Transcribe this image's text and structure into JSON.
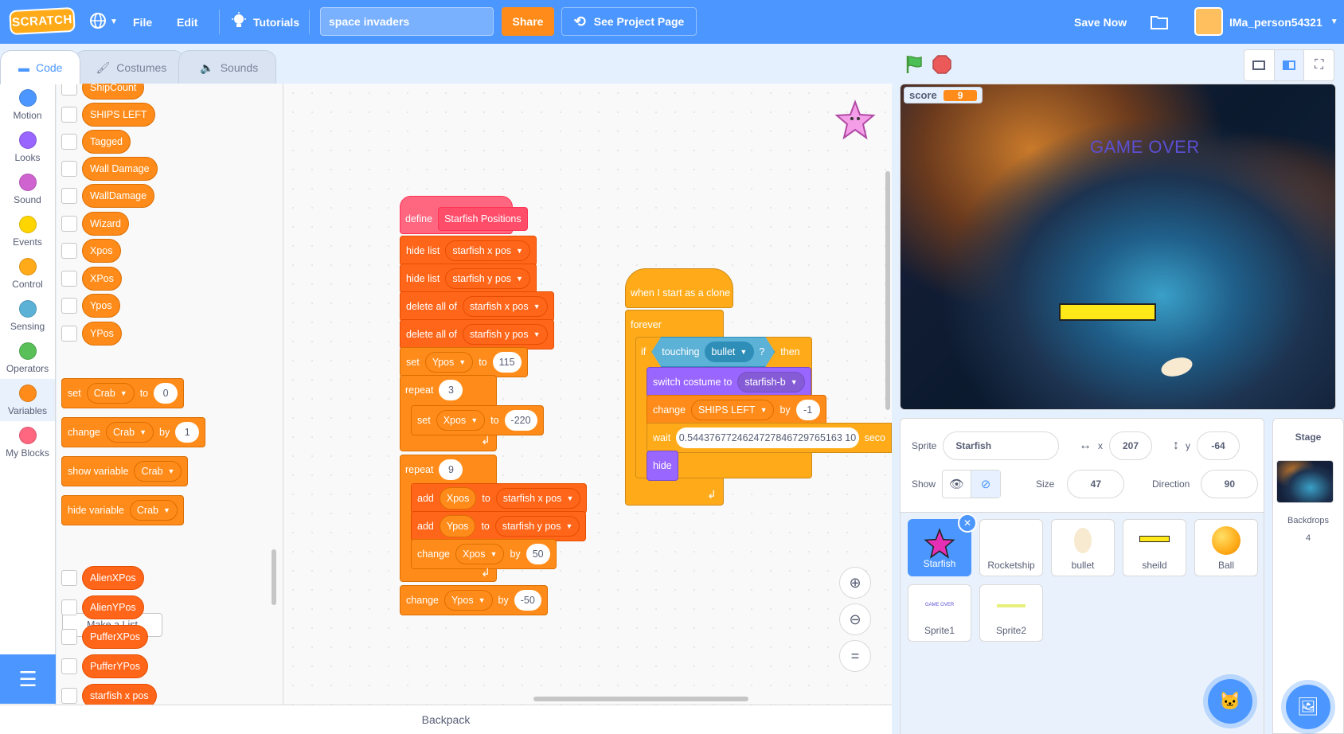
{
  "menu": {
    "logo": "SCRATCH",
    "file": "File",
    "edit": "Edit",
    "tutorials": "Tutorials",
    "project_title": "space invaders",
    "share": "Share",
    "see_project_page": "See Project Page",
    "save_now": "Save Now",
    "username": "IMa_person54321"
  },
  "tabs": {
    "code": "Code",
    "costumes": "Costumes",
    "sounds": "Sounds"
  },
  "categories": [
    {
      "label": "Motion",
      "color": "#4c97ff"
    },
    {
      "label": "Looks",
      "color": "#9966ff"
    },
    {
      "label": "Sound",
      "color": "#cf63cf"
    },
    {
      "label": "Events",
      "color": "#ffd500"
    },
    {
      "label": "Control",
      "color": "#ffab19"
    },
    {
      "label": "Sensing",
      "color": "#5cb1d6"
    },
    {
      "label": "Operators",
      "color": "#59c059"
    },
    {
      "label": "Variables",
      "color": "#ff8c1a"
    },
    {
      "label": "My Blocks",
      "color": "#ff6680"
    }
  ],
  "palette": {
    "variables": [
      "ShipCount",
      "SHIPS LEFT",
      "Tagged",
      "Wall Damage",
      "WallDamage",
      "Wizard",
      "Xpos",
      "XPos",
      "Ypos",
      "YPos"
    ],
    "set_block": {
      "label": "set",
      "var": "Crab",
      "to": "to",
      "value": "0"
    },
    "change_block": {
      "label": "change",
      "var": "Crab",
      "by": "by",
      "value": "1"
    },
    "show_block": {
      "label": "show variable",
      "var": "Crab"
    },
    "hide_block": {
      "label": "hide variable",
      "var": "Crab"
    },
    "make_list": "Make a List",
    "lists": [
      "AlienXPos",
      "AlienYPos",
      "PufferXPos",
      "PufferYPos",
      "starfish x pos"
    ]
  },
  "script1": {
    "define": "define",
    "proc_name": "Starfish Positions",
    "hide_list": "hide list",
    "list_x": "starfish x pos",
    "list_y": "starfish y pos",
    "delete_all": "delete all of",
    "set": "set",
    "ypos": "Ypos",
    "xpos": "Xpos",
    "to": "to",
    "set_ypos_val": "115",
    "repeat": "repeat",
    "repeat1_val": "3",
    "set_xpos_val": "-220",
    "repeat2_val": "9",
    "add": "add",
    "change": "change",
    "by": "by",
    "change_xpos_val": "50",
    "change_ypos_val": "-50"
  },
  "script2": {
    "hat": "when I start as a clone",
    "forever": "forever",
    "if": "if",
    "touching": "touching",
    "touch_target": "bullet",
    "q": "?",
    "then": "then",
    "switch_costume": "switch costume to",
    "costume": "starfish-b",
    "change": "change",
    "var": "SHIPS LEFT",
    "by": "by",
    "change_val": "-1",
    "wait": "wait",
    "wait_val": "0.5443767724624727846729765163 10",
    "secs": "seco",
    "hide": "hide"
  },
  "backpack": "Backpack",
  "stage": {
    "monitor_label": "score",
    "monitor_value": "9",
    "game_over": "GAME OVER"
  },
  "sprite_info": {
    "sprite_label": "Sprite",
    "sprite_name": "Starfish",
    "x_label": "x",
    "x": "207",
    "y_label": "y",
    "y": "-64",
    "show_label": "Show",
    "size_label": "Size",
    "size": "47",
    "direction_label": "Direction",
    "direction": "90"
  },
  "sprites": [
    "Starfish",
    "Rocketship",
    "bullet",
    "sheild",
    "Ball",
    "Sprite1",
    "Sprite2"
  ],
  "sprite_thumb_text": "GAME OVER",
  "stage_panel": {
    "title": "Stage",
    "backdrops_label": "Backdrops",
    "backdrops_count": "4"
  }
}
